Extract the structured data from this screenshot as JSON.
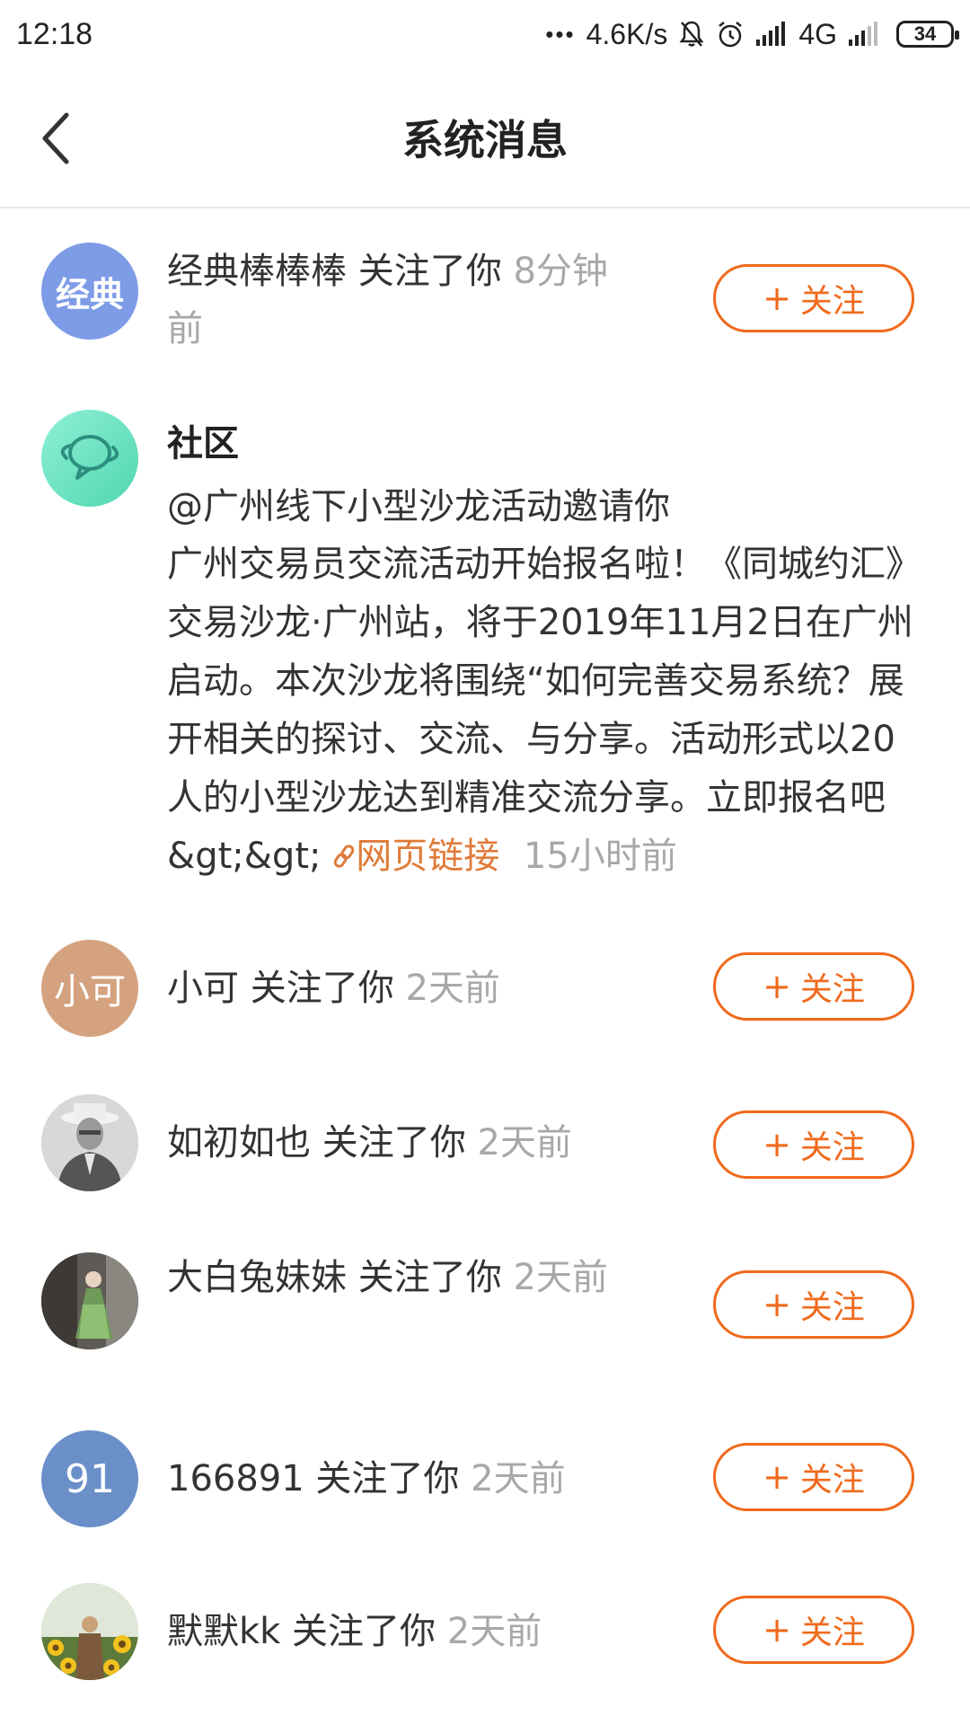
{
  "status_bar": {
    "time": "12:18",
    "dots": "•••",
    "speed": "4.6K/s",
    "network": "4G",
    "battery": "34"
  },
  "header": {
    "title": "系统消息"
  },
  "colors": {
    "accent": "#f06a1c",
    "time_gray": "#a8a8a8",
    "link": "#e07b3a"
  },
  "follow_label": "关注",
  "follow_plus": "+",
  "items": [
    {
      "avatar_text": "经典",
      "avatar_color": "#7d9be6",
      "name": "经典棒棒棒",
      "action": "关注了你",
      "time": "8分钟前"
    },
    {
      "avatar_icon": "chat-planet-icon",
      "title": "社区",
      "subtitle": "@广州线下小型沙龙活动邀请你",
      "body": "广州交易员交流活动开始报名啦！《同城约汇》交易沙龙·广州站，将于2019年11月2日在广州启动。本次沙龙将围绕“如何完善交易系统？展开相关的探讨、交流、与分享。活动形式以20人的小型沙龙达到精准交流分享。立即报名吧&gt;&gt;",
      "link_text": "网页链接",
      "time": "15小时前"
    },
    {
      "avatar_text": "小可",
      "avatar_color": "#d4a27e",
      "name": "小可",
      "action": "关注了你",
      "time": "2天前"
    },
    {
      "avatar_icon": "photo-man-hat",
      "name": "如初如也",
      "action": "关注了你",
      "time": "2天前"
    },
    {
      "avatar_icon": "photo-woman-dress",
      "name": "大白兔妹妹",
      "action": "关注了你",
      "time": "2天前"
    },
    {
      "avatar_text": "91",
      "avatar_color": "#6a8fc9",
      "name": "166891",
      "action": "关注了你",
      "time": "2天前"
    },
    {
      "avatar_icon": "photo-sunflowers",
      "name": "默默kk",
      "action": "关注了你",
      "time": "2天前"
    }
  ]
}
